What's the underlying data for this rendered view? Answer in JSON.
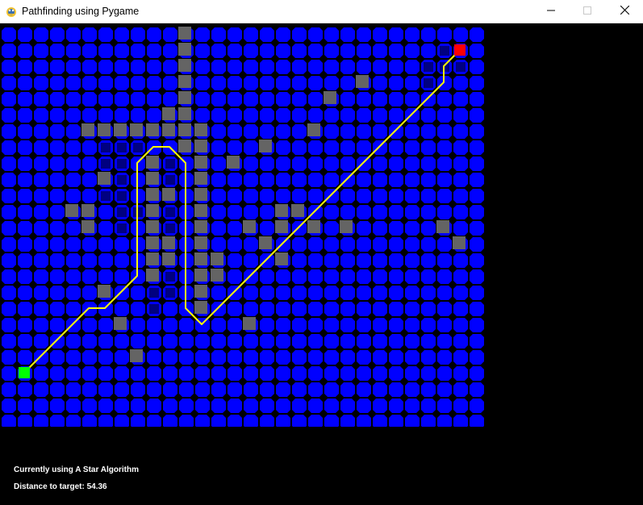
{
  "window": {
    "title": "Pathfinding using Pygame",
    "icon": "pygame-snake-icon",
    "controls": [
      "minimize-icon",
      "maximize-icon",
      "close-icon"
    ]
  },
  "grid": {
    "columns": 30,
    "rows": 25,
    "colors": {
      "background": "#000000",
      "cell": "#0000ff",
      "explored_mark": "#000080",
      "wall": "#646464",
      "start": "#00ff00",
      "end": "#ff0000",
      "path": "#ffff00"
    },
    "walls": [
      [
        11,
        0
      ],
      [
        11,
        1
      ],
      [
        11,
        2
      ],
      [
        11,
        3
      ],
      [
        11,
        4
      ],
      [
        11,
        5
      ],
      [
        11,
        6
      ],
      [
        11,
        7
      ],
      [
        10,
        5
      ],
      [
        10,
        6
      ],
      [
        5,
        6
      ],
      [
        6,
        6
      ],
      [
        7,
        6
      ],
      [
        8,
        6
      ],
      [
        9,
        6
      ],
      [
        12,
        6
      ],
      [
        11,
        7
      ],
      [
        12,
        7
      ],
      [
        12,
        8
      ],
      [
        9,
        8
      ],
      [
        12,
        9
      ],
      [
        9,
        9
      ],
      [
        6,
        9
      ],
      [
        9,
        10
      ],
      [
        10,
        10
      ],
      [
        12,
        10
      ],
      [
        12,
        11
      ],
      [
        12,
        12
      ],
      [
        12,
        13
      ],
      [
        12,
        14
      ],
      [
        12,
        15
      ],
      [
        12,
        16
      ],
      [
        12,
        17
      ],
      [
        9,
        11
      ],
      [
        9,
        12
      ],
      [
        9,
        13
      ],
      [
        9,
        14
      ],
      [
        9,
        15
      ],
      [
        10,
        13
      ],
      [
        10,
        14
      ],
      [
        4,
        11
      ],
      [
        5,
        11
      ],
      [
        5,
        12
      ],
      [
        13,
        14
      ],
      [
        13,
        15
      ],
      [
        6,
        16
      ],
      [
        7,
        18
      ],
      [
        8,
        20
      ],
      [
        22,
        3
      ],
      [
        20,
        4
      ],
      [
        19,
        6
      ],
      [
        16,
        7
      ],
      [
        14,
        8
      ],
      [
        17,
        11
      ],
      [
        18,
        11
      ],
      [
        15,
        12
      ],
      [
        17,
        12
      ],
      [
        19,
        12
      ],
      [
        21,
        12
      ],
      [
        16,
        13
      ],
      [
        17,
        14
      ],
      [
        27,
        12
      ],
      [
        28,
        13
      ],
      [
        15,
        18
      ]
    ],
    "start": [
      1,
      21
    ],
    "end": [
      28,
      1
    ],
    "path": [
      [
        1,
        21
      ],
      [
        2,
        20
      ],
      [
        3,
        19
      ],
      [
        4,
        18
      ],
      [
        5,
        17
      ],
      [
        6,
        17
      ],
      [
        7,
        16
      ],
      [
        8,
        15
      ],
      [
        8,
        14
      ],
      [
        8,
        13
      ],
      [
        8,
        12
      ],
      [
        8,
        11
      ],
      [
        8,
        10
      ],
      [
        8,
        9
      ],
      [
        8,
        8
      ],
      [
        9,
        7
      ],
      [
        10,
        7
      ],
      [
        11,
        8
      ],
      [
        11,
        9
      ],
      [
        11,
        10
      ],
      [
        11,
        11
      ],
      [
        11,
        12
      ],
      [
        11,
        13
      ],
      [
        11,
        14
      ],
      [
        11,
        15
      ],
      [
        11,
        16
      ],
      [
        11,
        17
      ],
      [
        12,
        18
      ],
      [
        13,
        17
      ],
      [
        14,
        16
      ],
      [
        15,
        15
      ],
      [
        16,
        14
      ],
      [
        17,
        13
      ],
      [
        18,
        12
      ],
      [
        19,
        11
      ],
      [
        20,
        10
      ],
      [
        21,
        9
      ],
      [
        22,
        8
      ],
      [
        23,
        7
      ],
      [
        24,
        6
      ],
      [
        25,
        5
      ],
      [
        26,
        4
      ],
      [
        27,
        3
      ],
      [
        27,
        2
      ],
      [
        28,
        1
      ]
    ],
    "explored_cells": [
      [
        6,
        7
      ],
      [
        7,
        7
      ],
      [
        8,
        7
      ],
      [
        6,
        8
      ],
      [
        7,
        8
      ],
      [
        6,
        9
      ],
      [
        7,
        9
      ],
      [
        7,
        10
      ],
      [
        6,
        10
      ],
      [
        7,
        11
      ],
      [
        7,
        12
      ],
      [
        8,
        11
      ],
      [
        10,
        8
      ],
      [
        10,
        9
      ],
      [
        10,
        11
      ],
      [
        10,
        12
      ],
      [
        10,
        15
      ],
      [
        10,
        16
      ],
      [
        9,
        16
      ],
      [
        9,
        17
      ],
      [
        26,
        2
      ],
      [
        27,
        2
      ],
      [
        26,
        3
      ],
      [
        28,
        2
      ],
      [
        27,
        1
      ]
    ]
  },
  "status": {
    "algorithm_text": "Currently using A Star Algorithm",
    "distance_text": "Distance to target: 54.36"
  }
}
